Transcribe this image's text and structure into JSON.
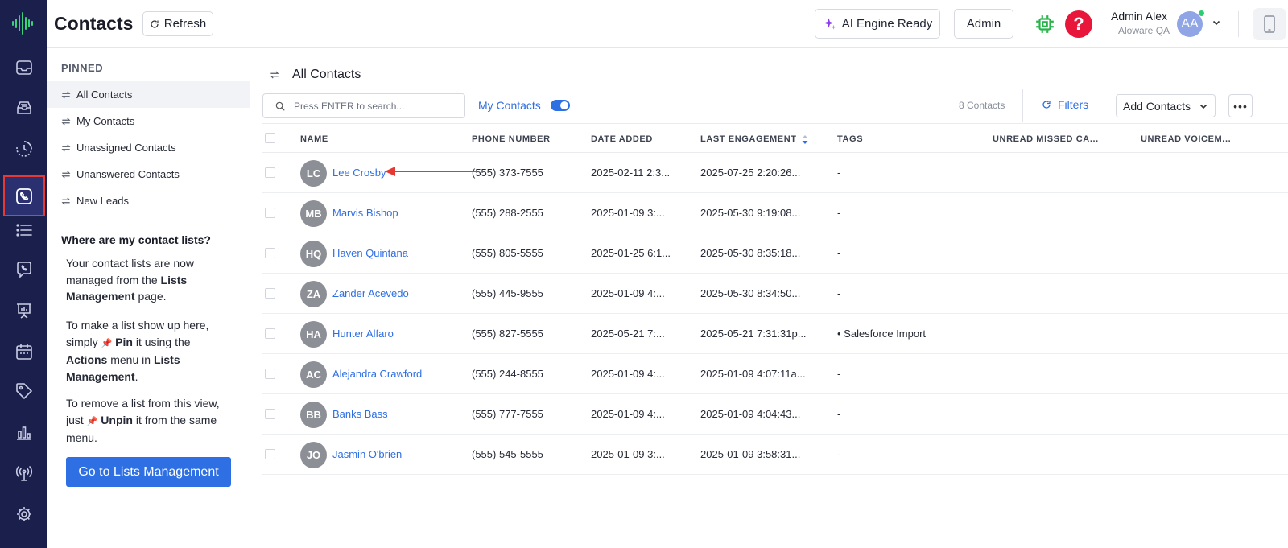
{
  "header": {
    "title": "Contacts",
    "refresh_label": "Refresh",
    "ai_label": "AI Engine Ready",
    "admin_label": "Admin",
    "help_glyph": "?",
    "user_name": "Admin Alex",
    "user_org": "Aloware QA",
    "user_initials": "AA"
  },
  "rail": {
    "icons": [
      "inbox-icon",
      "tray-icon",
      "clock-icon",
      "phone-book-icon",
      "list-icon",
      "chat-phone-icon",
      "presentation-icon",
      "calendar-icon",
      "tag-icon",
      "bar-chart-icon",
      "broadcast-icon",
      "settings-gear-icon"
    ],
    "active": "phone-book-icon"
  },
  "sidebar": {
    "pinned_heading": "PINNED",
    "items": [
      {
        "label": "All Contacts",
        "active": true
      },
      {
        "label": "My Contacts",
        "active": false
      },
      {
        "label": "Unassigned Contacts",
        "active": false
      },
      {
        "label": "Unanswered Contacts",
        "active": false
      },
      {
        "label": "New Leads",
        "active": false
      }
    ],
    "help_title": "Where are my contact lists?",
    "p1_a": "Your contact lists are now managed from the ",
    "p1_b": "Lists Management",
    "p1_c": " page.",
    "p2_a": "To make a list show up here, simply ",
    "p2_b": "Pin",
    "p2_c": " it using the ",
    "p2_d": "Actions",
    "p2_e": " menu in ",
    "p2_f": "Lists Management",
    "p2_g": ".",
    "p3_a": "To remove a list from this view, just ",
    "p3_b": "Unpin",
    "p3_c": " it from the same menu.",
    "pin_glyph": "📌",
    "lists_button": "Go to Lists Management"
  },
  "main": {
    "list_title": "All Contacts",
    "search_placeholder": "Press ENTER to search...",
    "my_contacts_label": "My Contacts",
    "my_contacts_on": true,
    "count_label": "8 Contacts",
    "filters_label": "Filters",
    "add_contacts_label": "Add Contacts",
    "more_label": "•••"
  },
  "table": {
    "columns": [
      "NAME",
      "PHONE NUMBER",
      "DATE ADDED",
      "LAST ENGAGEMENT",
      "TAGS",
      "UNREAD MISSED CA...",
      "UNREAD VOICEM..."
    ],
    "rows": [
      {
        "initials": "LC",
        "name": "Lee Crosby",
        "phone": "(555) 373-7555",
        "date_added": "2025-02-11 2:3...",
        "last_engagement": "2025-07-25 2:20:26...",
        "tags": "-"
      },
      {
        "initials": "MB",
        "name": "Marvis Bishop",
        "phone": "(555) 288-2555",
        "date_added": "2025-01-09 3:...",
        "last_engagement": "2025-05-30 9:19:08...",
        "tags": "-"
      },
      {
        "initials": "HQ",
        "name": "Haven Quintana",
        "phone": "(555) 805-5555",
        "date_added": "2025-01-25 6:1...",
        "last_engagement": "2025-05-30 8:35:18...",
        "tags": "-"
      },
      {
        "initials": "ZA",
        "name": "Zander Acevedo",
        "phone": "(555) 445-9555",
        "date_added": "2025-01-09 4:...",
        "last_engagement": "2025-05-30 8:34:50...",
        "tags": "-"
      },
      {
        "initials": "HA",
        "name": "Hunter Alfaro",
        "phone": "(555) 827-5555",
        "date_added": "2025-05-21 7:...",
        "last_engagement": "2025-05-21 7:31:31p...",
        "tags": "• Salesforce Import"
      },
      {
        "initials": "AC",
        "name": "Alejandra Crawford",
        "phone": "(555) 244-8555",
        "date_added": "2025-01-09 4:...",
        "last_engagement": "2025-01-09 4:07:11a...",
        "tags": "-"
      },
      {
        "initials": "BB",
        "name": "Banks Bass",
        "phone": "(555) 777-7555",
        "date_added": "2025-01-09 4:...",
        "last_engagement": "2025-01-09 4:04:43...",
        "tags": "-"
      },
      {
        "initials": "JO",
        "name": "Jasmin O'brien",
        "phone": "(555) 545-5555",
        "date_added": "2025-01-09 3:...",
        "last_engagement": "2025-01-09 3:58:31...",
        "tags": "-"
      }
    ]
  },
  "colors": {
    "rail_bg": "#1b1f4b",
    "accent": "#2f6fe4",
    "highlight_red": "#e53935",
    "help_red": "#e8163b",
    "chip_green": "#27b34a"
  }
}
